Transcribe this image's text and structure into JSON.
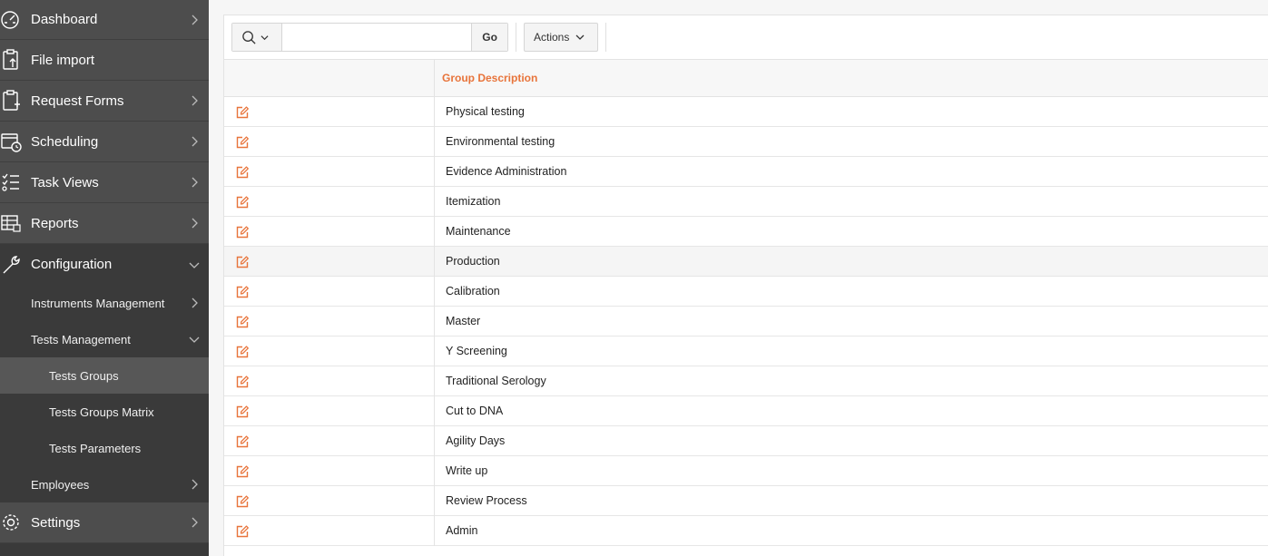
{
  "sidebar": {
    "items": [
      {
        "label": "Dashboard",
        "icon": "dashboard-icon"
      },
      {
        "label": "File import",
        "icon": "file-import-icon"
      },
      {
        "label": "Request Forms",
        "icon": "request-forms-icon"
      },
      {
        "label": "Scheduling",
        "icon": "calendar-clock-icon"
      },
      {
        "label": "Task Views",
        "icon": "checklist-icon"
      },
      {
        "label": "Reports",
        "icon": "reports-icon"
      },
      {
        "label": "Configuration",
        "icon": "wrench-icon"
      },
      {
        "label": "Settings",
        "icon": "gear-icon"
      }
    ],
    "sub_items": [
      {
        "label": "Instruments Management"
      },
      {
        "label": "Tests Management"
      },
      {
        "label": "Employees"
      }
    ],
    "sub_sub_items": [
      {
        "label": "Tests Groups",
        "active": true
      },
      {
        "label": "Tests Groups Matrix"
      },
      {
        "label": "Tests Parameters"
      }
    ]
  },
  "toolbar": {
    "search_icon": "search-icon",
    "search_value": "",
    "go_label": "Go",
    "actions_label": "Actions"
  },
  "grid": {
    "column_header": "Group Description",
    "edit_icon": "edit-icon",
    "rows": [
      "Physical testing",
      "Environmental testing",
      "Evidence Administration",
      "Itemization",
      "Maintenance",
      "Production",
      "Calibration",
      "Master",
      "Y Screening",
      "Traditional Serology",
      "Cut to DNA",
      "Agility Days",
      "Write up",
      "Review Process",
      "Admin"
    ],
    "highlighted_row_index": 5
  },
  "colors": {
    "sidebar_bg": "#3a3a3a",
    "sidebar_item_bg": "#4d4d4d",
    "active_bg": "#575757",
    "accent_orange": "#e8743b"
  }
}
